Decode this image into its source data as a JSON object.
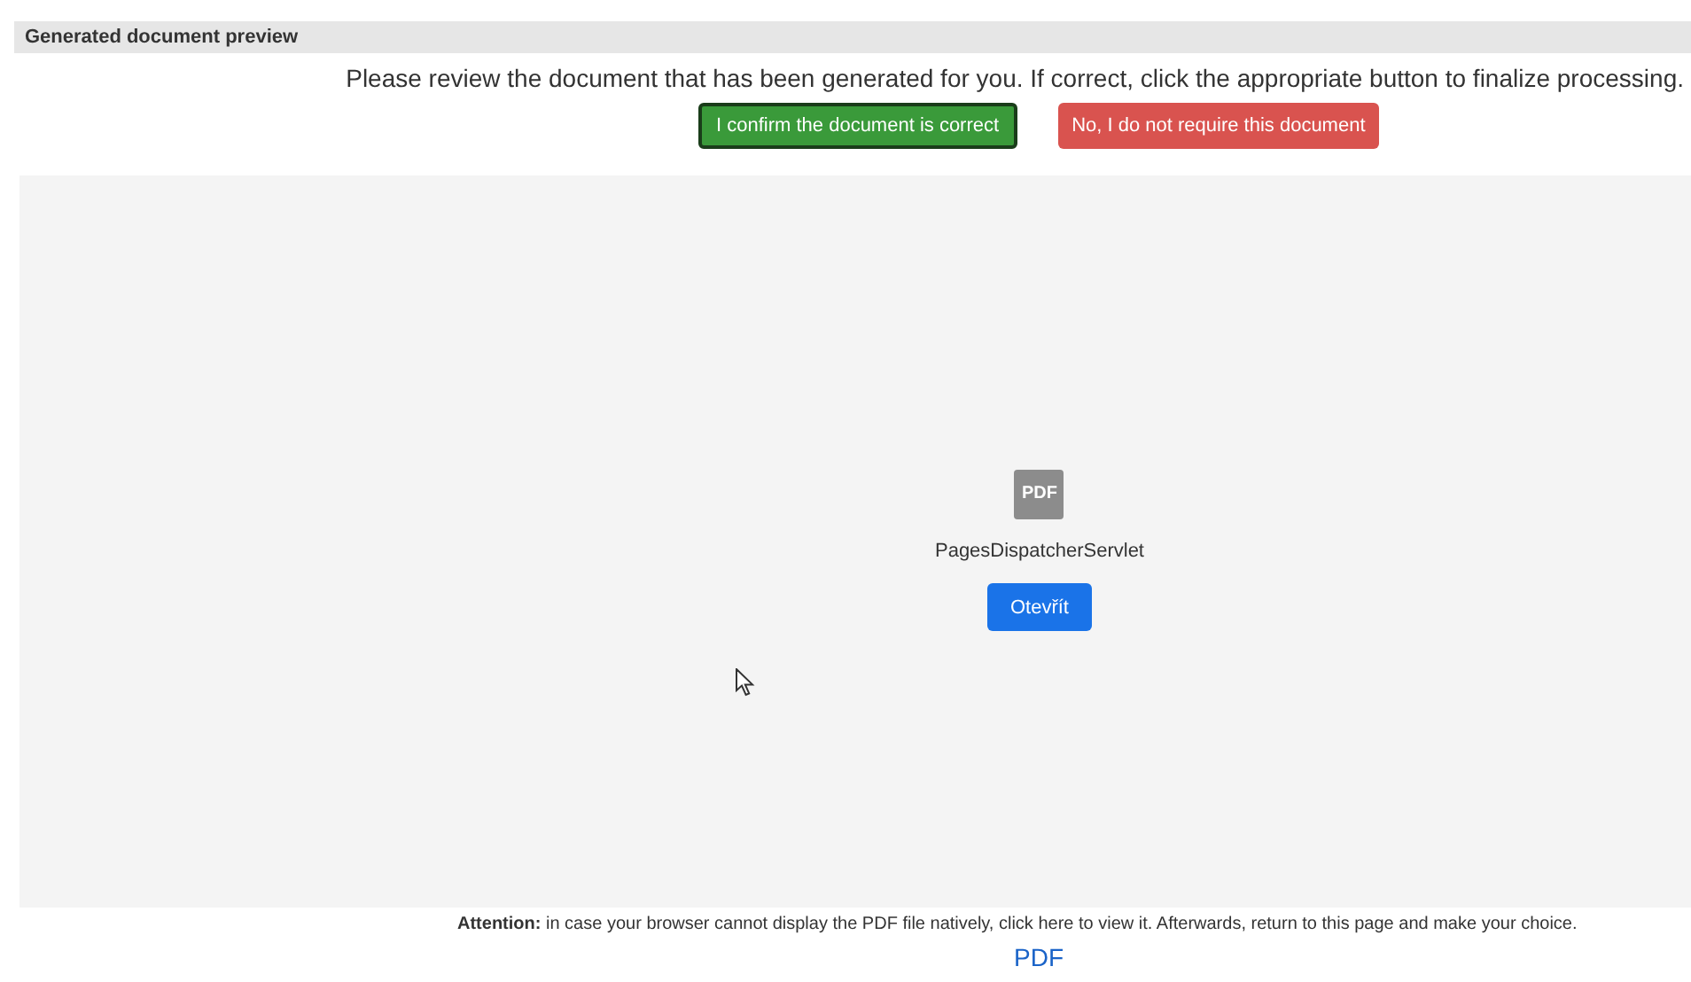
{
  "header": {
    "title": "Generated document preview"
  },
  "instruction": "Please review the document that has been generated for you. If correct, click the appropriate button to finalize processing.",
  "buttons": [
    {
      "label": "I confirm the document is correct",
      "kind": "confirm"
    },
    {
      "label": "No, I do not require this document",
      "kind": "reject"
    }
  ],
  "viewer": {
    "file_icon_label": "PDF",
    "file_name": "PagesDispatcherServlet",
    "open_button": "Otevřít"
  },
  "notice": "**Attention:** in case your browser cannot display the PDF file natively, click here to view it. Afterwards, return to this page and make your choice.",
  "link": "PDF"
}
